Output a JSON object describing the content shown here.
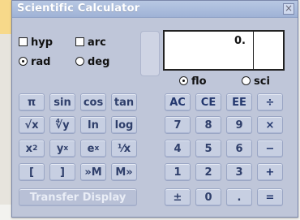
{
  "window": {
    "title": "Scientific Calculator",
    "close_glyph": "×"
  },
  "options": {
    "hyp_label": "hyp",
    "arc_label": "arc",
    "rad_label": "rad",
    "deg_label": "deg",
    "flo_label": "flo",
    "sci_label": "sci",
    "hyp_checked": false,
    "arc_checked": false,
    "angle_mode": "rad",
    "number_format": "flo"
  },
  "display": {
    "value": "0."
  },
  "buttons": {
    "pi": "π",
    "sin": "sin",
    "cos": "cos",
    "tan": "tan",
    "sqrt": "√x",
    "root": "∜y",
    "ln": "ln",
    "log": "log",
    "square_base": "x",
    "square_sup": "2",
    "power_base": "y",
    "power_sup": "x",
    "exp_base": "e",
    "exp_sup": "x",
    "reciprocal": "¹⁄x",
    "paren_open": "[",
    "paren_close": "]",
    "mem_store": "»M",
    "mem_recall": "M»",
    "transfer": "Transfer Display",
    "ac": "AC",
    "ce": "CE",
    "ee": "EE",
    "divide": "÷",
    "d7": "7",
    "d8": "8",
    "d9": "9",
    "multiply": "×",
    "d4": "4",
    "d5": "5",
    "d6": "6",
    "minus": "−",
    "d1": "1",
    "d2": "2",
    "d3": "3",
    "plus": "+",
    "plus_minus": "±",
    "d0": "0",
    "dot": ".",
    "equals": "="
  }
}
